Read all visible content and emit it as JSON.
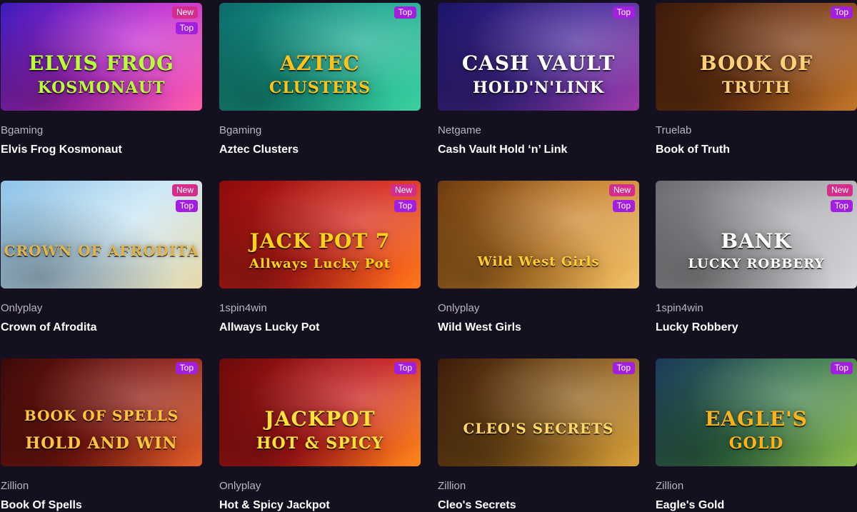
{
  "games": [
    {
      "provider": "Bgaming",
      "name": "Elvis Frog Kosmonaut",
      "badges": [
        "New",
        "Top"
      ],
      "art_text": "ELVIS FROG",
      "art_sub": "KOSMONAUT",
      "colors": [
        "#3a1bb8",
        "#c22bd1",
        "#ff5fa8"
      ],
      "art_color": "#b8ff3a"
    },
    {
      "provider": "Bgaming",
      "name": "Aztec Clusters",
      "badges": [
        "Top"
      ],
      "art_text": "AZTEC",
      "art_sub": "CLUSTERS",
      "colors": [
        "#0d6a6a",
        "#1aa98f",
        "#3ad1a0"
      ],
      "art_color": "#ffc21a"
    },
    {
      "provider": "Netgame",
      "name": "Cash Vault Hold ‘n’ Link",
      "badges": [
        "Top"
      ],
      "art_text": "CASH VAULT",
      "art_sub": "HOLD'N'LINK",
      "colors": [
        "#1a1466",
        "#4b2a9c",
        "#9d3aa8"
      ],
      "art_color": "#ffffff"
    },
    {
      "provider": "Truelab",
      "name": "Book of Truth",
      "badges": [
        "Top"
      ],
      "art_text": "BOOK OF",
      "art_sub": "TRUTH",
      "colors": [
        "#3a1a0a",
        "#7a3a12",
        "#c2762a"
      ],
      "art_color": "#ffd27a"
    },
    {
      "provider": "Onlyplay",
      "name": "Crown of Afrodita",
      "badges": [
        "New",
        "Top"
      ],
      "art_text": "CROWN OF AFRODITA",
      "art_sub": "",
      "colors": [
        "#8fc3e8",
        "#c9e6f5",
        "#e8d9a8"
      ],
      "art_color": "#e0b44a"
    },
    {
      "provider": "1spin4win",
      "name": "Allways Lucky Pot",
      "badges": [
        "New",
        "Top"
      ],
      "art_text": "JACK POT 7",
      "art_sub": "Allways Lucky Pot",
      "colors": [
        "#8a0b0b",
        "#d4241a",
        "#ff7a1a"
      ],
      "art_color": "#ffd21a"
    },
    {
      "provider": "Onlyplay",
      "name": "Wild West Girls",
      "badges": [
        "New",
        "Top"
      ],
      "art_text": "",
      "art_sub": "Wild West Girls",
      "colors": [
        "#6a3a10",
        "#c9822a",
        "#f2c46a"
      ],
      "art_color": "#ffcc33"
    },
    {
      "provider": "1spin4win",
      "name": "Lucky Robbery",
      "badges": [
        "New",
        "Top"
      ],
      "art_text": "BANK",
      "art_sub": "LUCKY ROBBERY",
      "colors": [
        "#6a6a6e",
        "#a9a9ad",
        "#d9d9dc"
      ],
      "art_color": "#ffffff"
    },
    {
      "provider": "Zillion",
      "name": "Book Of Spells",
      "badges": [
        "Top"
      ],
      "art_text": "BOOK OF SPELLS",
      "art_sub": "HOLD AND WIN",
      "colors": [
        "#3a0a0a",
        "#8a1a12",
        "#e0602a"
      ],
      "art_color": "#ffc63a"
    },
    {
      "provider": "Onlyplay",
      "name": "Hot & Spicy Jackpot",
      "badges": [
        "Top"
      ],
      "art_text": "JACKPOT",
      "art_sub": "HOT & SPICY",
      "colors": [
        "#6a0a0a",
        "#c41a1a",
        "#ff8a1a"
      ],
      "art_color": "#ffe23a"
    },
    {
      "provider": "Zillion",
      "name": "Cleo's Secrets",
      "badges": [
        "Top"
      ],
      "art_text": "CLEO'S SECRETS",
      "art_sub": "",
      "colors": [
        "#3a1a0a",
        "#8a5a1a",
        "#d9a23a"
      ],
      "art_color": "#ffd86a"
    },
    {
      "provider": "Zillion",
      "name": "Eagle's Gold",
      "badges": [
        "Top"
      ],
      "art_text": "EAGLE'S",
      "art_sub": "GOLD",
      "colors": [
        "#1a3a5a",
        "#3a7a4a",
        "#8ab84a"
      ],
      "art_color": "#ffb21a"
    }
  ]
}
